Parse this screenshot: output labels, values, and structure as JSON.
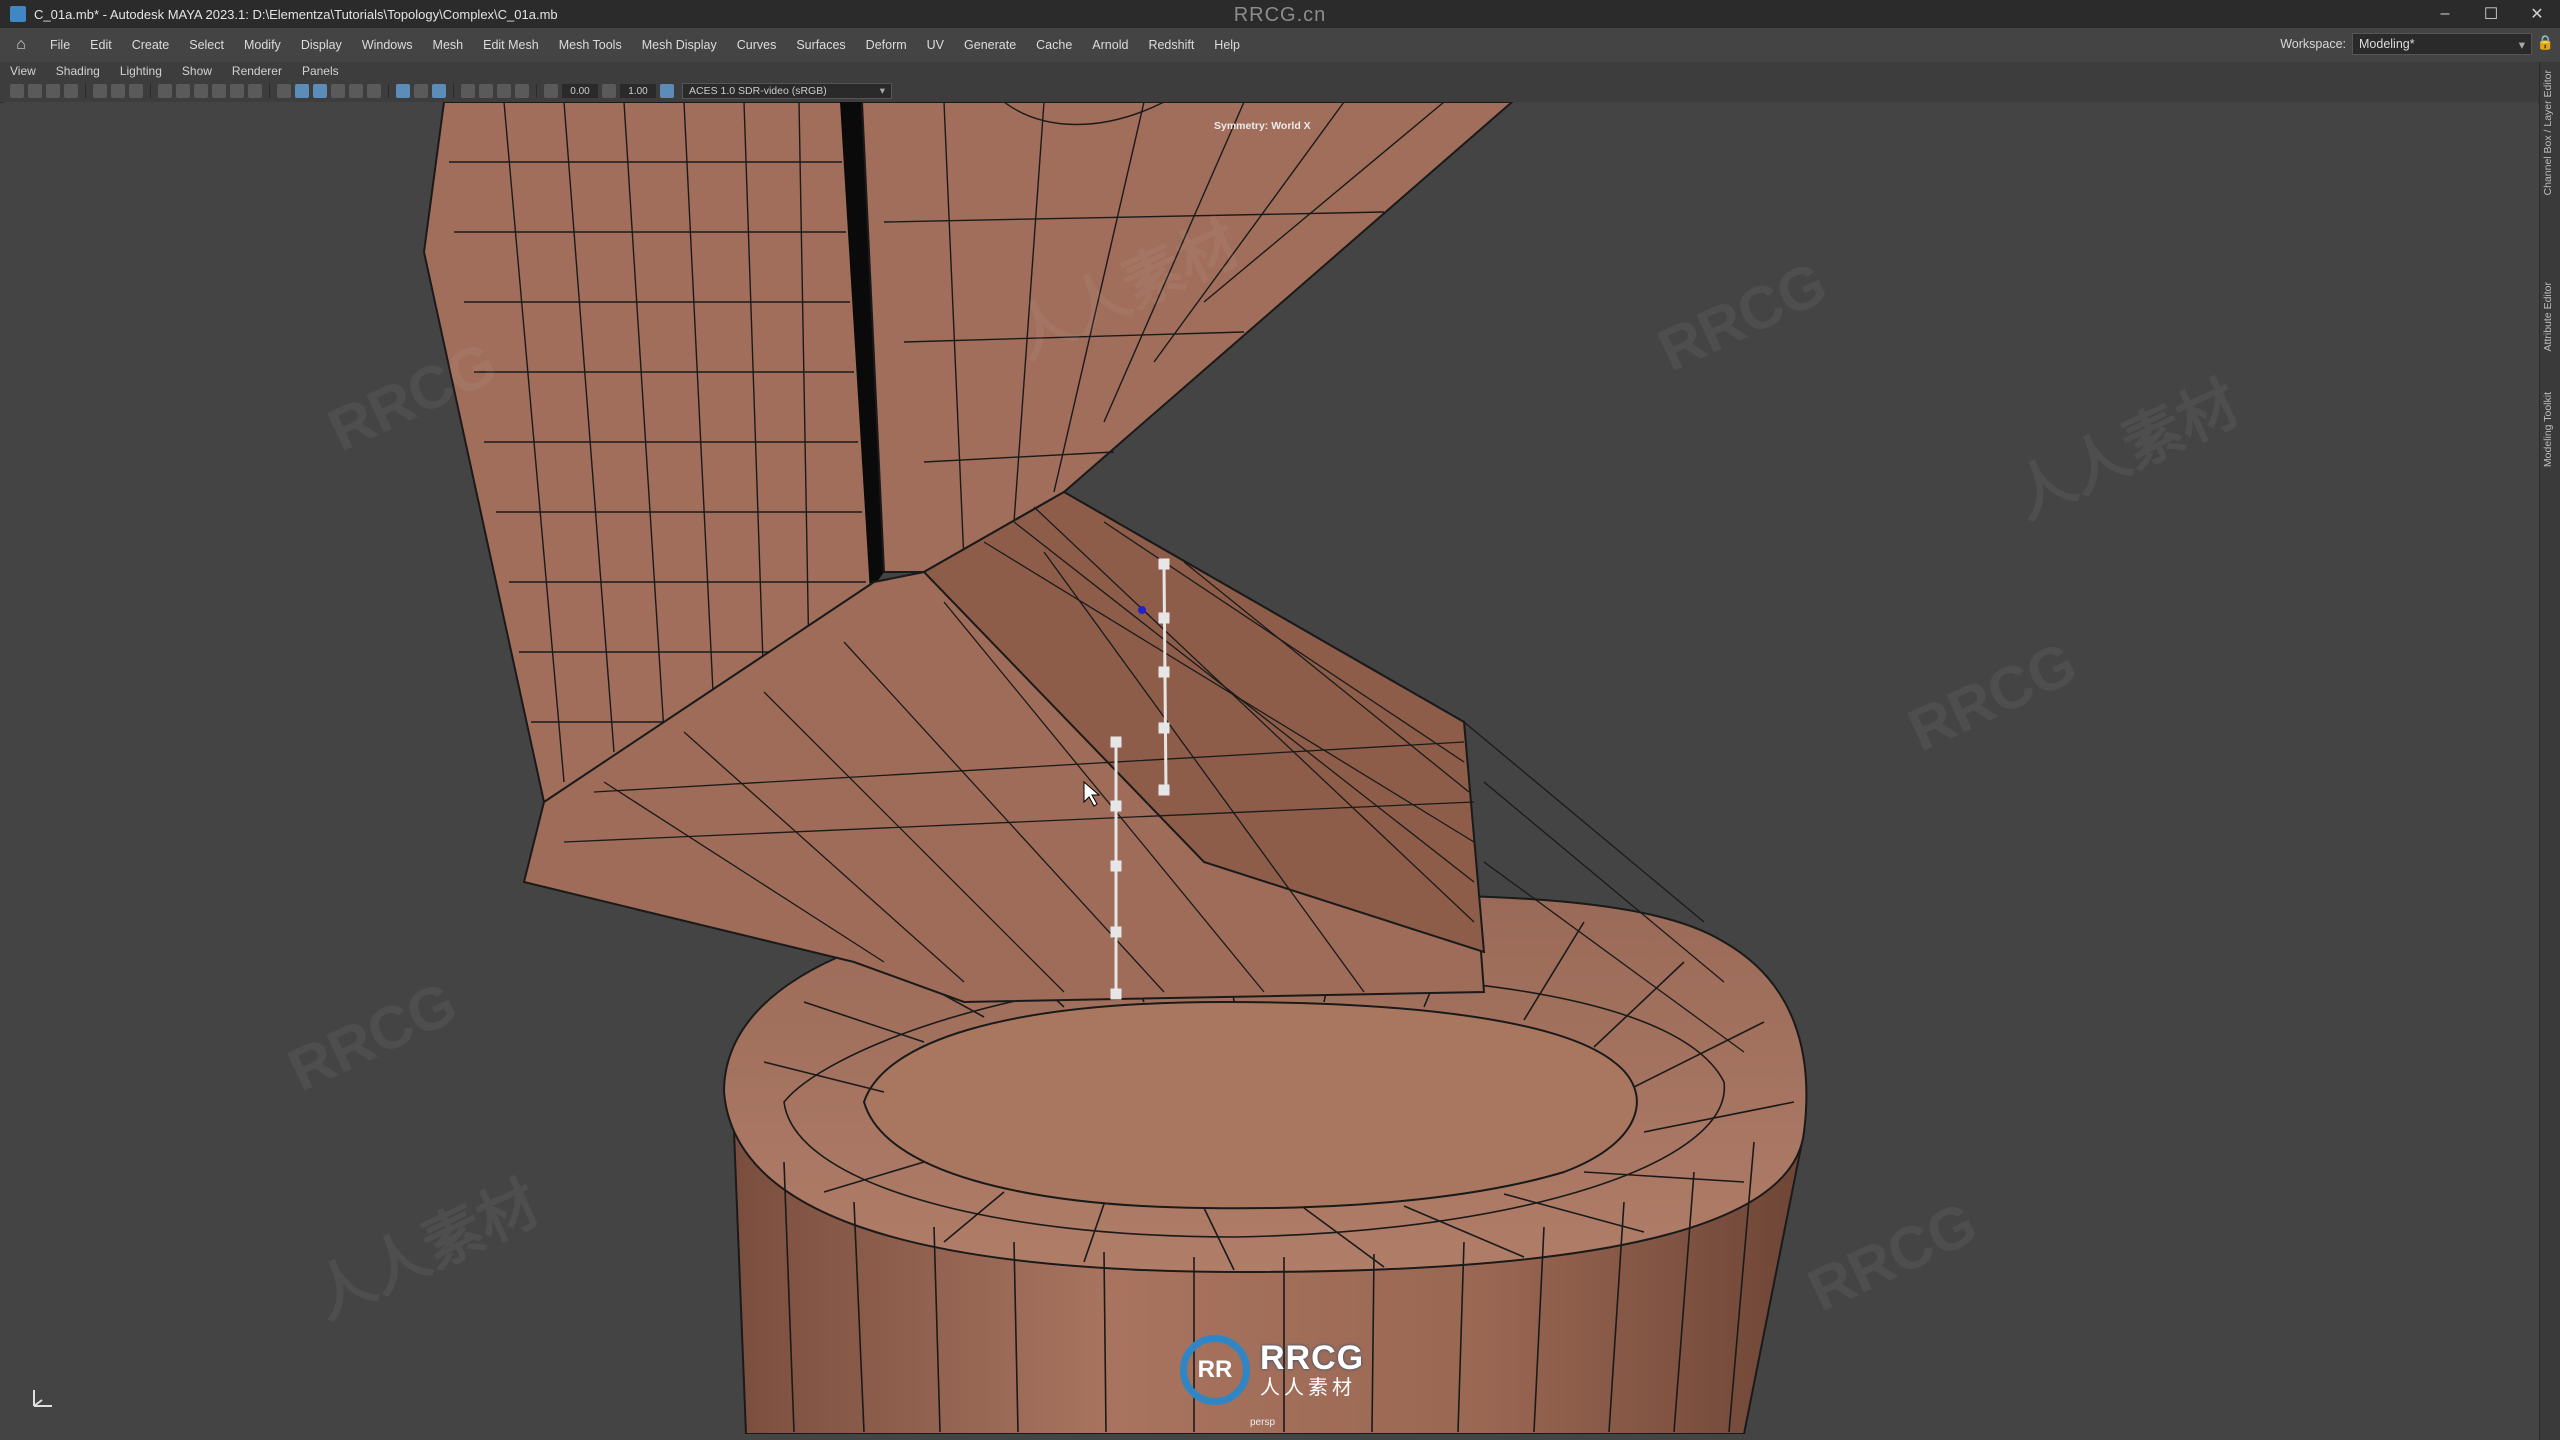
{
  "window": {
    "title": "C_01a.mb* - Autodesk MAYA 2023.1: D:\\Elementza\\Tutorials\\Topology\\Complex\\C_01a.mb",
    "watermark": "RRCG.cn",
    "controls": [
      "–",
      "☐",
      "✕"
    ]
  },
  "menubar": {
    "items": [
      "File",
      "Edit",
      "Create",
      "Select",
      "Modify",
      "Display",
      "Windows",
      "Mesh",
      "Edit Mesh",
      "Mesh Tools",
      "Mesh Display",
      "Curves",
      "Surfaces",
      "Deform",
      "UV",
      "Generate",
      "Cache",
      "Arnold",
      "Redshift",
      "Help"
    ],
    "workspace_label": "Workspace:",
    "workspace_value": "Modeling*"
  },
  "panel_menu": {
    "items": [
      "View",
      "Shading",
      "Lighting",
      "Show",
      "Renderer",
      "Panels"
    ]
  },
  "panel_toolbar": {
    "field_a": "0.00",
    "field_b": "1.00",
    "color_management": "ACES 1.0 SDR-video (sRGB)"
  },
  "viewport": {
    "symmetry": "Symmetry: World X",
    "camera": "persp",
    "mesh_color": "#a06e5a",
    "wire_color": "#1a1a1a",
    "selection_color": "#e6e6e6",
    "watermarks": [
      "RRCG",
      "人人素材"
    ],
    "logo": {
      "mark": "RR",
      "line1": "RRCG",
      "line2": "人人素材"
    }
  },
  "side_tabs": [
    "Channel Box / Layer Editor",
    "Attribute Editor",
    "Modeling Toolkit"
  ]
}
